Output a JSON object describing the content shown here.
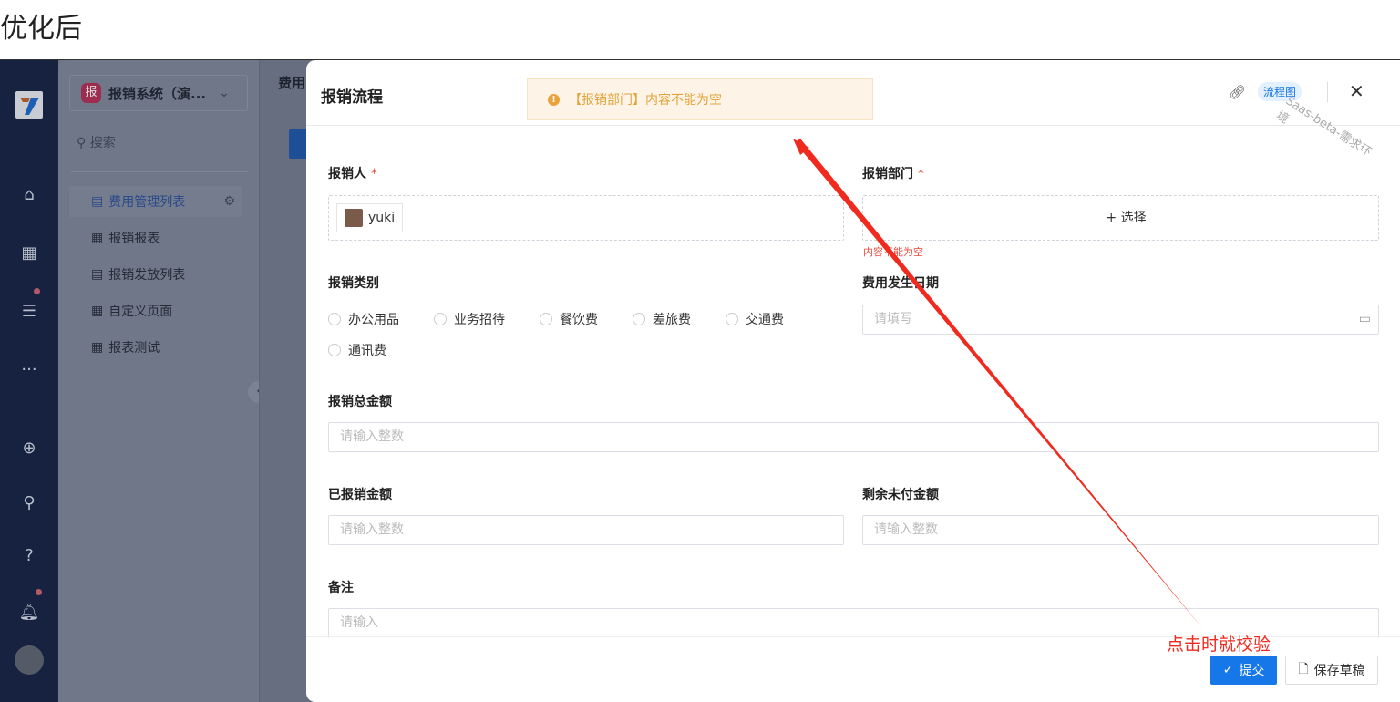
{
  "caption": "优化后",
  "app": {
    "name": "报销系统（演...",
    "badge": "报",
    "search_placeholder": "搜索",
    "nav": [
      {
        "label": "费用管理列表",
        "icon": "list-icon"
      },
      {
        "label": "报销报表",
        "icon": "grid-icon"
      },
      {
        "label": "报销发放列表",
        "icon": "list-icon"
      },
      {
        "label": "自定义页面",
        "icon": "grid-icon"
      },
      {
        "label": "报表测试",
        "icon": "grid-icon"
      }
    ],
    "main_title": "费用"
  },
  "modal": {
    "title": "报销流程",
    "alert": "【报销部门】内容不能为空",
    "flow_label": "流程图",
    "watermark": "Saas-beta-需求环境",
    "fields": {
      "reporter": {
        "label": "报销人",
        "value": "yuki"
      },
      "dept": {
        "label": "报销部门",
        "button": "选择",
        "error": "内容不能为空"
      },
      "category": {
        "label": "报销类别",
        "options": [
          "办公用品",
          "业务招待",
          "餐饮费",
          "差旅费",
          "交通费",
          "通讯费"
        ]
      },
      "date": {
        "label": "费用发生日期",
        "placeholder": "请填写"
      },
      "total": {
        "label": "报销总金额",
        "placeholder": "请输入整数"
      },
      "paid": {
        "label": "已报销金额",
        "placeholder": "请输入整数"
      },
      "unpaid": {
        "label": "剩余未付金额",
        "placeholder": "请输入整数"
      },
      "note": {
        "label": "备注",
        "placeholder": "请输入"
      }
    },
    "submit": "提交",
    "draft": "保存草稿"
  },
  "annotation": "点击时就校验",
  "colors": {
    "primary": "#1677e8",
    "error": "#e74c3c",
    "warning": "#e3a33a",
    "annotation": "#f02a1e"
  }
}
